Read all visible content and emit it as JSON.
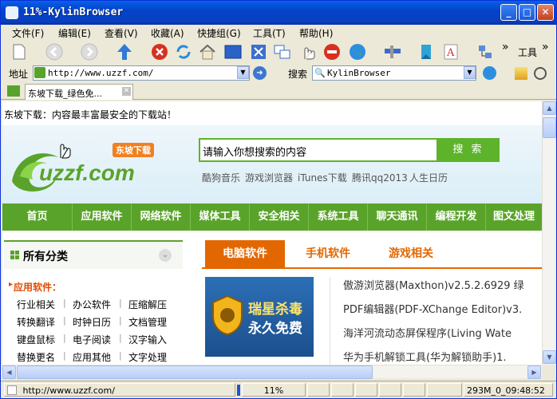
{
  "window": {
    "title": "11%-KylinBrowser"
  },
  "menus": [
    "文件(F)",
    "编辑(E)",
    "查看(V)",
    "收藏(A)",
    "快捷组(G)",
    "工具(T)",
    "帮助(H)"
  ],
  "toolbar": {
    "overflow_label": "工具"
  },
  "address": {
    "label": "地址",
    "url": "http://www.uzzf.com/"
  },
  "search": {
    "label": "搜索",
    "value": "KylinBrowser"
  },
  "tab": {
    "title": "东坡下载_绿色免..."
  },
  "page": {
    "slogan": "东坡下载：内容最丰富最安全的下载站！",
    "logo_text": "uzzf.com",
    "logo_badge": "东坡下载",
    "search_placeholder": "请输入你想搜索的内容",
    "search_button": "搜 索",
    "hot_links": [
      "酷狗音乐",
      "游戏浏览器",
      "iTunes下载",
      "腾讯qq2013",
      "人生日历"
    ],
    "nav": [
      "首页",
      "应用软件",
      "网络软件",
      "媒体工具",
      "安全相关",
      "系统工具",
      "聊天通讯",
      "编程开发",
      "图文处理"
    ],
    "categories_title": "所有分类",
    "subcategory_title": "应用软件：",
    "category_links": [
      [
        "行业相关",
        "办公软件",
        "压缩解压"
      ],
      [
        "转换翻译",
        "时钟日历",
        "文档管理"
      ],
      [
        "键盘鼠标",
        "电子阅读",
        "汉字输入"
      ],
      [
        "替换更名",
        "应用其他",
        "文字处理"
      ]
    ],
    "right_tabs": [
      "电脑软件",
      "手机软件",
      "游戏相关"
    ],
    "promo_line1": "瑞星杀毒",
    "promo_line2": "永久免费",
    "news": [
      "傲游浏览器(Maxthon)v2.5.2.6929 绿",
      "PDF编辑器(PDF-XChange Editor)v3.",
      "海洋河流动态屏保程序(Living Wate",
      "华为手机解锁工具(华为解锁助手)1."
    ]
  },
  "status": {
    "url": "http://www.uzzf.com/",
    "zoom": "11%",
    "memory": "293M_0_09:48:52"
  },
  "colors": {
    "titlebar": "#0244c9",
    "nav_green": "#5aa32b",
    "tab_orange": "#e36700"
  }
}
